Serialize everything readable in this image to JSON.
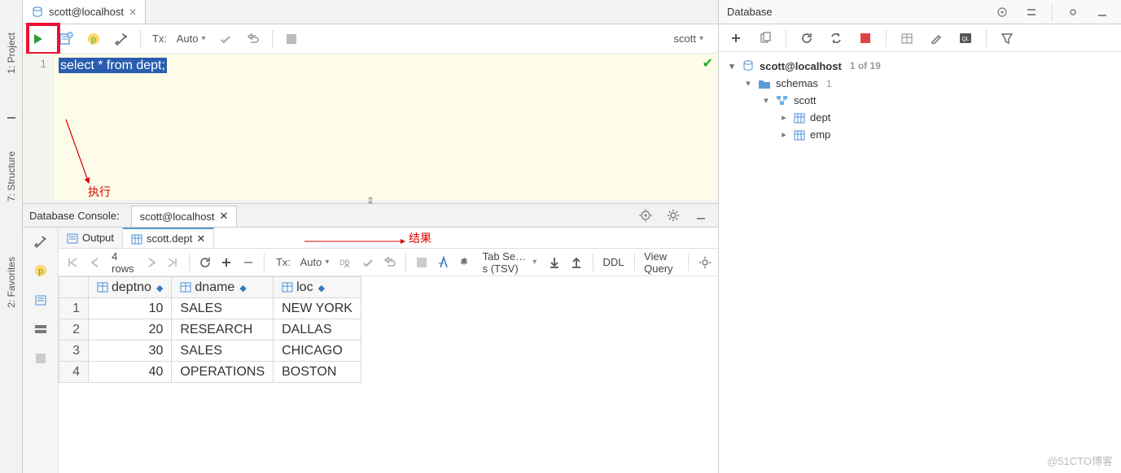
{
  "sidebar": {
    "project": "1: Project",
    "structure": "7: Structure",
    "favorites": "2: Favorites"
  },
  "editor": {
    "tab_title": "scott@localhost",
    "tx_label": "Tx:",
    "tx_mode": "Auto",
    "schema": "scott",
    "line_no": "1",
    "sql": "select * from dept;"
  },
  "annotations": {
    "execute": "执行",
    "result": "结果"
  },
  "console": {
    "title": "Database Console:",
    "tab": "scott@localhost",
    "output_tab": "Output",
    "result_tab": "scott.dept"
  },
  "results": {
    "row_count": "4 rows",
    "tx_label": "Tx:",
    "tx_mode": "Auto",
    "tab_sep": "Tab Se…s (TSV)",
    "ddl": "DDL",
    "view_query": "View Query",
    "columns": [
      "deptno",
      "dname",
      "loc"
    ],
    "rows": [
      {
        "n": "1",
        "deptno": "10",
        "dname": "SALES",
        "loc": "NEW YORK"
      },
      {
        "n": "2",
        "deptno": "20",
        "dname": "RESEARCH",
        "loc": "DALLAS"
      },
      {
        "n": "3",
        "deptno": "30",
        "dname": "SALES",
        "loc": "CHICAGO"
      },
      {
        "n": "4",
        "deptno": "40",
        "dname": "OPERATIONS",
        "loc": "BOSTON"
      }
    ]
  },
  "db_panel": {
    "title": "Database",
    "root": "scott@localhost",
    "root_count": "1 of 19",
    "schemas_label": "schemas",
    "schemas_count": "1",
    "schema": "scott",
    "tables": [
      "dept",
      "emp"
    ]
  },
  "watermark": "@51CTO博客"
}
